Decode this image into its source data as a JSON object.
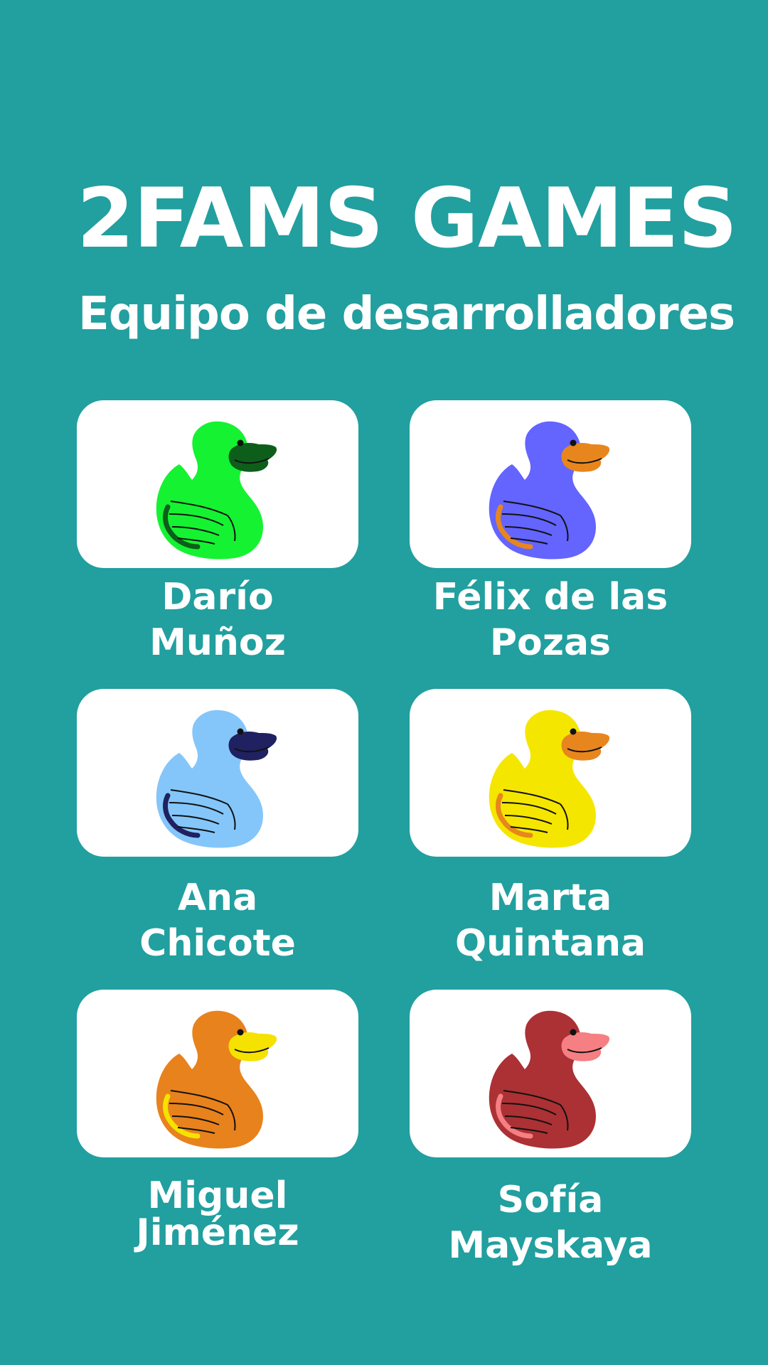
{
  "header": {
    "title": "2FAMS GAMES",
    "subtitle": "Equipo de desarrolladores"
  },
  "team": [
    {
      "first": "Darío",
      "last": "Muñoz",
      "icon": "green-rubber-duck-icon",
      "body_color": "#15f232",
      "beak_color": "#0d5e1a"
    },
    {
      "first": "Félix de las",
      "last": "Pozas",
      "icon": "purple-rubber-duck-icon",
      "body_color": "#6464ff",
      "beak_color": "#e8861e"
    },
    {
      "first": "Ana",
      "last": "Chicote",
      "icon": "light-blue-rubber-duck-icon",
      "body_color": "#84c6f9",
      "beak_color": "#1f2160"
    },
    {
      "first": "Marta",
      "last": "Quintana",
      "icon": "yellow-rubber-duck-icon",
      "body_color": "#f5e600",
      "beak_color": "#e8861e"
    },
    {
      "first": "Miguel",
      "last": "Jiménez",
      "icon": "orange-rubber-duck-icon",
      "body_color": "#e8821c",
      "beak_color": "#f5e200"
    },
    {
      "first": "Sofía",
      "last": "Mayskaya",
      "icon": "red-rubber-duck-icon",
      "body_color": "#ab3134",
      "beak_color": "#f57f82"
    }
  ]
}
